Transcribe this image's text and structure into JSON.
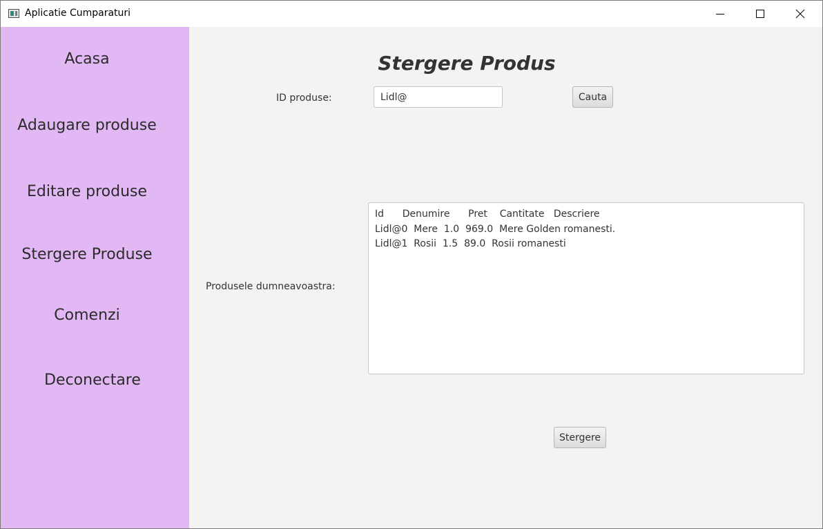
{
  "window": {
    "title": "Aplicatie Cumparaturi",
    "controls": {
      "minimize_icon": "minimize-icon",
      "maximize_icon": "maximize-icon",
      "close_icon": "close-icon"
    }
  },
  "sidebar": {
    "background": "#e2b8f4",
    "items": [
      {
        "label": "Acasa"
      },
      {
        "label": "Adaugare produse"
      },
      {
        "label": "Editare produse"
      },
      {
        "label": "Stergere Produse"
      },
      {
        "label": "Comenzi"
      },
      {
        "label": "Deconectare"
      }
    ]
  },
  "main": {
    "title": "Stergere Produs",
    "id_label": "ID produse:",
    "id_input_value": "Lidl@",
    "search_button": "Cauta",
    "products_label": "Produsele dumneavoastra:",
    "products_text": {
      "lines": [
        "Id      Denumire      Pret    Cantitate   Descriere",
        "Lidl@0  Mere  1.0  969.0  Mere Golden romanesti.",
        "Lidl@1  Rosii  1.5  89.0  Rosii romanesti"
      ]
    },
    "delete_button": "Stergere"
  }
}
